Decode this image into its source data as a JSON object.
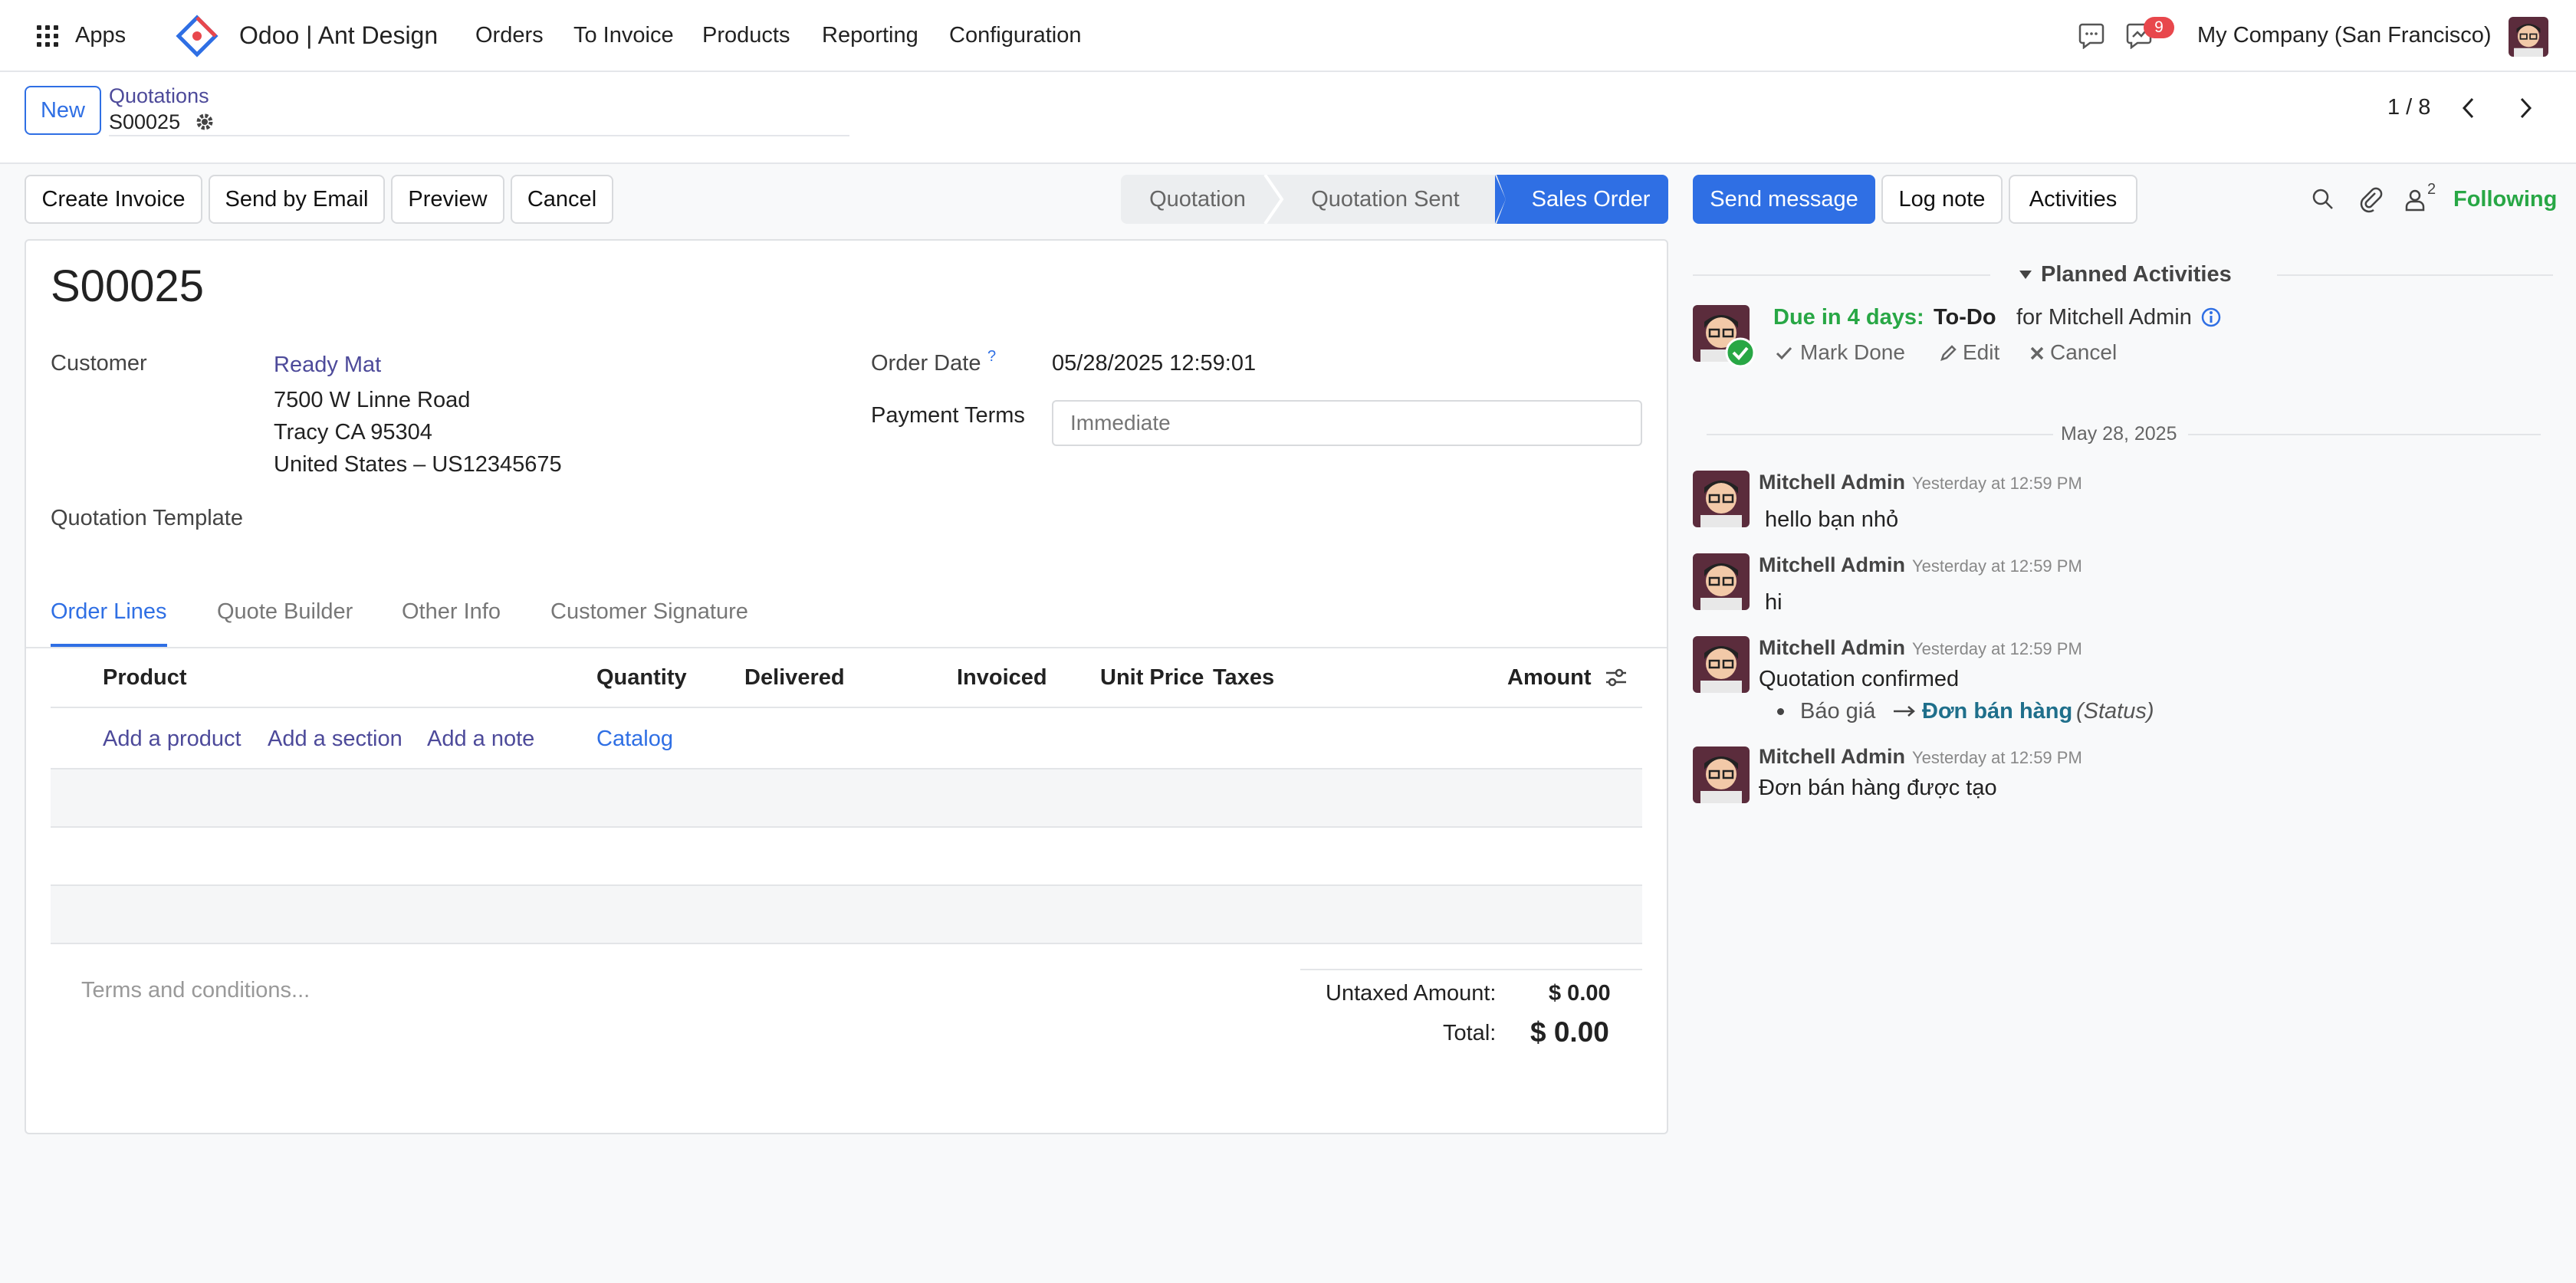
{
  "navbar": {
    "apps_label": "Apps",
    "brand": "Odoo | Ant Design",
    "menu": [
      "Orders",
      "To Invoice",
      "Products",
      "Reporting",
      "Configuration"
    ],
    "notification_count": "9",
    "company": "My Company (San Francisco)"
  },
  "control_panel": {
    "new_label": "New",
    "breadcrumb_parent": "Quotations",
    "record_name": "S00025",
    "pager": "1 / 8"
  },
  "actions": {
    "create_invoice": "Create Invoice",
    "send_by_email": "Send by Email",
    "preview": "Preview",
    "cancel": "Cancel"
  },
  "statusbar": {
    "stages": [
      "Quotation",
      "Quotation Sent",
      "Sales Order"
    ],
    "active": "Sales Order"
  },
  "form": {
    "title": "S00025",
    "customer_label": "Customer",
    "customer_name": "Ready Mat",
    "address_line1": "7500 W Linne Road",
    "address_line2": "Tracy CA 95304",
    "address_line3": "United States – US12345675",
    "template_label": "Quotation Template",
    "order_date_label": "Order Date",
    "order_date_help": "?",
    "order_date_value": "05/28/2025 12:59:01",
    "payment_terms_label": "Payment Terms",
    "payment_terms_placeholder": "Immediate"
  },
  "tabs": [
    "Order Lines",
    "Quote Builder",
    "Other Info",
    "Customer Signature"
  ],
  "table": {
    "headers": {
      "product": "Product",
      "quantity": "Quantity",
      "delivered": "Delivered",
      "invoiced": "Invoiced",
      "unit_price": "Unit Price",
      "taxes": "Taxes",
      "amount": "Amount"
    },
    "add_product": "Add a product",
    "add_section": "Add a section",
    "add_note": "Add a note",
    "catalog": "Catalog"
  },
  "totals": {
    "terms_placeholder": "Terms and conditions...",
    "untaxed_label": "Untaxed Amount:",
    "untaxed_value": "$ 0.00",
    "total_label": "Total:",
    "total_value": "$ 0.00"
  },
  "chatter": {
    "send_message": "Send message",
    "log_note": "Log note",
    "activities": "Activities",
    "followers_count": "2",
    "following": "Following",
    "planned_title": "Planned Activities",
    "activity": {
      "due": "Due in 4 days:",
      "type": "To-Do",
      "for": "for Mitchell Admin",
      "mark_done": "Mark Done",
      "edit": "Edit",
      "cancel": "Cancel"
    },
    "date_separator": "May 28, 2025",
    "messages": [
      {
        "author": "Mitchell Admin",
        "time": "Yesterday at 12:59 PM",
        "body": "hello bạn nhỏ"
      },
      {
        "author": "Mitchell Admin",
        "time": "Yesterday at 12:59 PM",
        "body": "hi"
      },
      {
        "author": "Mitchell Admin",
        "time": "Yesterday at 12:59 PM",
        "body": "Quotation confirmed",
        "change_old": "Báo giá",
        "change_new": "Đơn bán hàng",
        "change_field": "(Status)"
      },
      {
        "author": "Mitchell Admin",
        "time": "Yesterday at 12:59 PM",
        "body": "Đơn bán hàng được tạo"
      }
    ]
  },
  "colors": {
    "primary": "#2f6fe4",
    "link": "#4d4a9a",
    "success": "#28a745",
    "badge": "#e8474c"
  }
}
